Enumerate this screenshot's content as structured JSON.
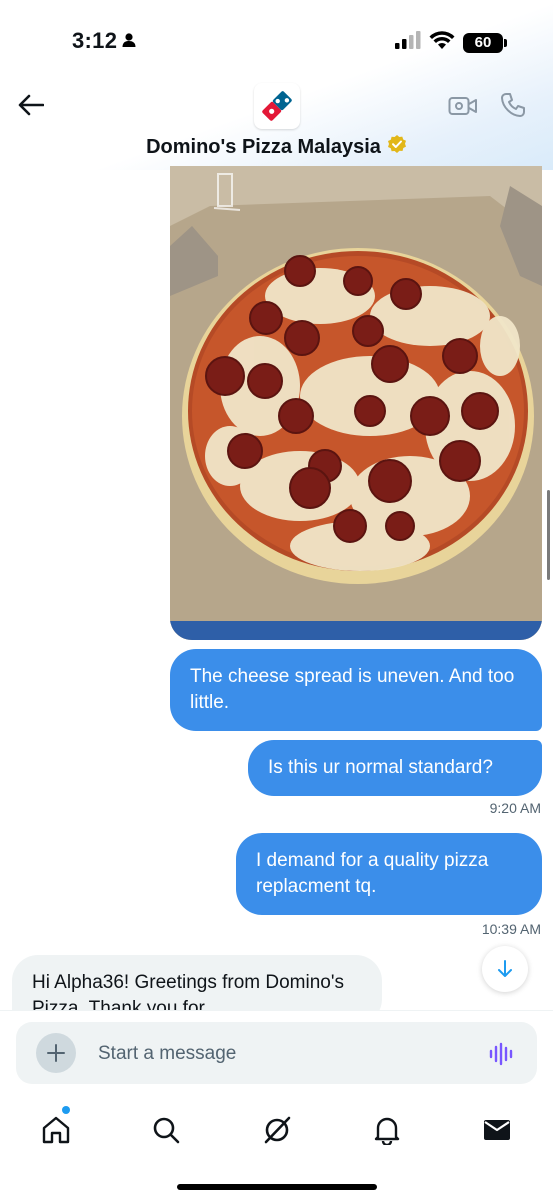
{
  "status_bar": {
    "time": "3:12",
    "battery": "60"
  },
  "header": {
    "title": "Domino's Pizza Malaysia"
  },
  "messages": {
    "m1": "The cheese spread is uneven. And too little.",
    "m2": "Is this ur normal standard?",
    "ts1": "9:20 AM",
    "m3": "I demand for a quality pizza replacment tq.",
    "ts2": "10:39 AM",
    "m4": "Hi Alpha36! Greetings from Domino's Pizza. Thank you for"
  },
  "composer": {
    "placeholder": "Start a message"
  },
  "colors": {
    "accent": "#1d9bf0",
    "outgoing_bubble": "#3b8eea",
    "incoming_bubble": "#eff3f4",
    "voice_icon": "#7856ff"
  },
  "icons": {
    "back": "arrow-left-icon",
    "video": "video-call-icon",
    "call": "phone-icon",
    "verified": "verified-badge-icon",
    "plus": "plus-icon",
    "voice": "voice-wave-icon",
    "scroll": "arrow-down-icon",
    "home": "home-icon",
    "search": "search-icon",
    "grok": "grok-icon",
    "notifications": "bell-icon",
    "messages": "envelope-icon"
  }
}
